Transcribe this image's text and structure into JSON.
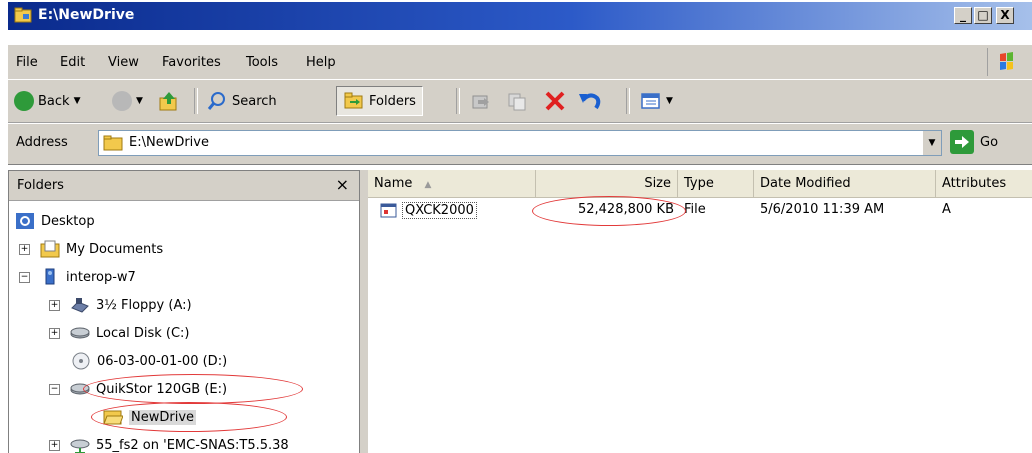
{
  "window": {
    "title": "E:\\NewDrive"
  },
  "caption_buttons": {
    "minimize": "_",
    "maximize": "□",
    "close": "X"
  },
  "menu": [
    "File",
    "Edit",
    "View",
    "Favorites",
    "Tools",
    "Help"
  ],
  "toolbar": {
    "back": "Back",
    "search": "Search",
    "folders": "Folders"
  },
  "address": {
    "label": "Address",
    "value": "E:\\NewDrive",
    "go": "Go"
  },
  "folders_pane": {
    "title": "Folders",
    "close_glyph": "×",
    "tree": [
      {
        "label": "Desktop",
        "expander": "",
        "icon": "desktop-icon"
      },
      {
        "label": "My Documents",
        "expander": "+",
        "icon": "my-documents-icon"
      },
      {
        "label": "interop-w7",
        "expander": "−",
        "icon": "computer-icon"
      },
      {
        "label": "3½ Floppy (A:)",
        "expander": "+",
        "icon": "floppy-icon"
      },
      {
        "label": "Local Disk (C:)",
        "expander": "+",
        "icon": "hard-disk-icon"
      },
      {
        "label": "06-03-00-01-00 (D:)",
        "expander": "",
        "icon": "cd-drive-icon"
      },
      {
        "label": "QuikStor 120GB (E:)",
        "expander": "−",
        "icon": "removable-drive-icon"
      },
      {
        "label": "NewDrive",
        "expander": "",
        "icon": "folder-open-icon"
      },
      {
        "label": "55_fs2 on 'EMC-SNAS:T5.5.38",
        "expander": "+",
        "icon": "network-drive-icon"
      }
    ]
  },
  "file_list": {
    "columns": [
      "Name",
      "Size",
      "Type",
      "Date Modified",
      "Attributes"
    ],
    "sort_indicator": "▲",
    "rows": [
      {
        "name": "QXCK2000",
        "size": "52,428,800 KB",
        "type": "File",
        "date_modified": "5/6/2010 11:39 AM",
        "attributes": "A"
      }
    ]
  },
  "colors": {
    "title_bar": "#0a2a8c",
    "highlight_oval": "#e23a3a",
    "chrome": "#d4d0c8"
  }
}
